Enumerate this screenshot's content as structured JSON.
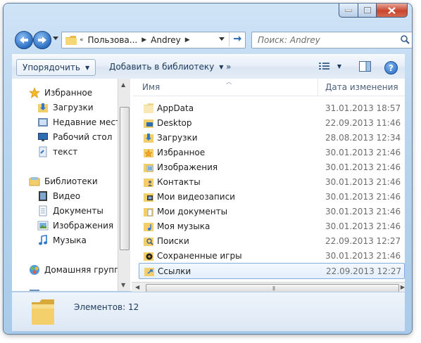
{
  "window": {
    "caption_buttons": [
      {
        "name": "minimize",
        "icon": "minimize-icon"
      },
      {
        "name": "maximize",
        "icon": "maximize-icon"
      },
      {
        "name": "close",
        "icon": "close-icon"
      }
    ]
  },
  "address": {
    "segments": [
      "Пользова...",
      "Andrey"
    ],
    "overflow": "«"
  },
  "search": {
    "placeholder": "Поиск: Andrey"
  },
  "toolbar": {
    "organize_label": "Упорядочить",
    "library_label": "Добавить в библиотеку",
    "more_label": "»",
    "help_label": "?"
  },
  "nav": {
    "favorites": {
      "label": "Избранное",
      "items": [
        "Загрузки",
        "Недавние места",
        "Рабочий стол",
        "текст"
      ]
    },
    "libraries": {
      "label": "Библиотеки",
      "items": [
        "Видео",
        "Документы",
        "Изображения",
        "Музыка"
      ]
    },
    "homegroup": {
      "label": "Домашняя группа"
    }
  },
  "columns": {
    "name": "Имя",
    "date": "Дата изменения"
  },
  "files": [
    {
      "name": "AppData",
      "date": "31.01.2013 18:57",
      "icon": "folder-faded-icon"
    },
    {
      "name": "Desktop",
      "date": "22.09.2013 11:46",
      "icon": "desktop-folder-icon"
    },
    {
      "name": "Загрузки",
      "date": "28.08.2013 12:34",
      "icon": "downloads-folder-icon"
    },
    {
      "name": "Избранное",
      "date": "30.01.2013 21:46",
      "icon": "favorites-folder-icon"
    },
    {
      "name": "Изображения",
      "date": "30.01.2013 21:46",
      "icon": "pictures-folder-icon"
    },
    {
      "name": "Контакты",
      "date": "30.01.2013 21:46",
      "icon": "contacts-folder-icon"
    },
    {
      "name": "Мои видеозаписи",
      "date": "30.01.2013 21:46",
      "icon": "videos-folder-icon"
    },
    {
      "name": "Мои документы",
      "date": "30.01.2013 21:46",
      "icon": "documents-folder-icon"
    },
    {
      "name": "Моя музыка",
      "date": "30.01.2013 21:46",
      "icon": "music-folder-icon"
    },
    {
      "name": "Поиски",
      "date": "22.09.2013 12:27",
      "icon": "searches-folder-icon"
    },
    {
      "name": "Сохраненные игры",
      "date": "30.01.2013 21:46",
      "icon": "saved-games-folder-icon"
    },
    {
      "name": "Ссылки",
      "date": "22.09.2013 12:27",
      "icon": "links-folder-icon",
      "selected": true
    }
  ],
  "status": {
    "items_text": "Элементов: 12"
  },
  "colors": {
    "window_frame": "#b9d5ef",
    "selection_border": "#84acdd",
    "folder_yellow": "#f2cf6b"
  }
}
